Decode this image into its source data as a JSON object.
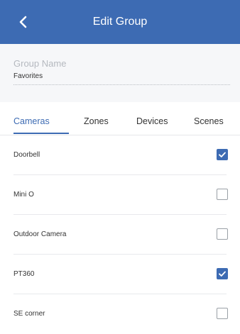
{
  "header": {
    "title": "Edit Group",
    "back_icon": "chevron-left-icon"
  },
  "group_name": {
    "label": "Group Name",
    "value": "Favorites"
  },
  "tabs": [
    {
      "label": "Cameras",
      "active": true
    },
    {
      "label": "Zones",
      "active": false
    },
    {
      "label": "Devices",
      "active": false
    },
    {
      "label": "Scenes",
      "active": false
    }
  ],
  "items": [
    {
      "label": "Doorbell",
      "checked": true
    },
    {
      "label": "Mini O",
      "checked": false
    },
    {
      "label": "Outdoor Camera",
      "checked": false
    },
    {
      "label": "PT360",
      "checked": true
    },
    {
      "label": "SE corner",
      "checked": false
    }
  ],
  "colors": {
    "accent": "#3d6bb3",
    "header_bg": "#3d6bb3",
    "section_bg": "#f6f7f9"
  }
}
